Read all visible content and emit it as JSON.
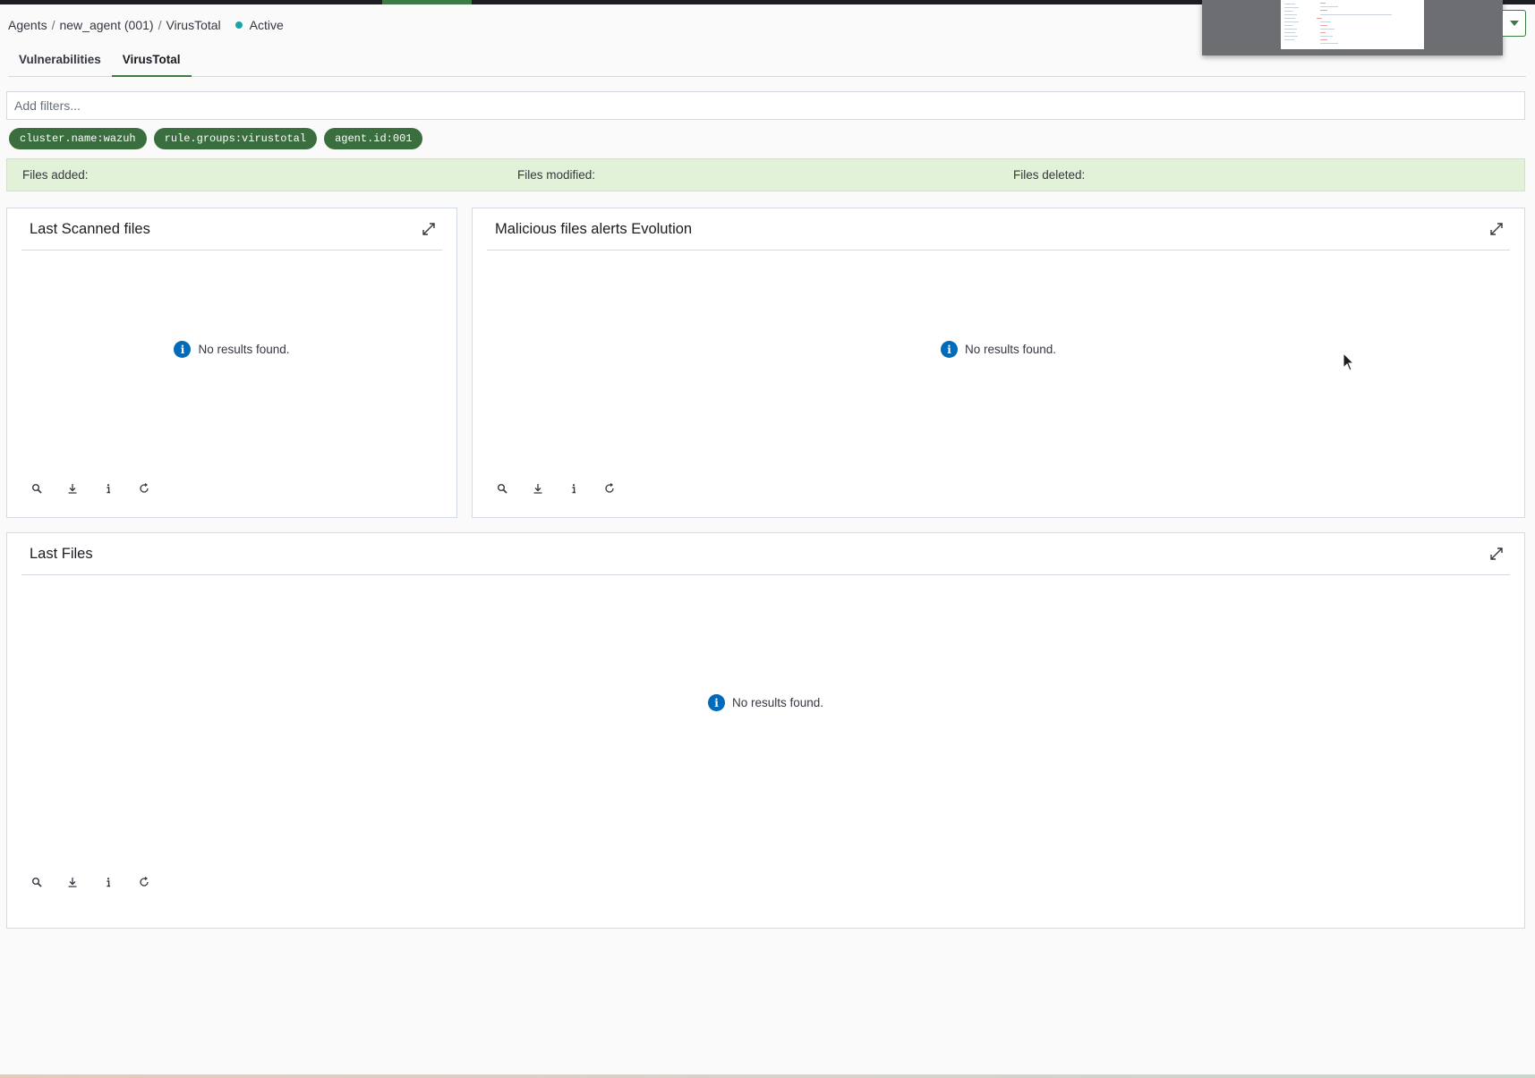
{
  "breadcrumb": {
    "agents": "Agents",
    "agent": "new_agent (001)",
    "current": "VirusTotal",
    "separator": "/"
  },
  "status": {
    "label": "Active",
    "color": "#1aa5a5"
  },
  "tabs": [
    {
      "label": "Vulnerabilities",
      "active": false
    },
    {
      "label": "VirusTotal",
      "active": true
    }
  ],
  "filter": {
    "placeholder": "Add filters..."
  },
  "pills": [
    "cluster.name:wazuh",
    "rule.groups:virustotal",
    "agent.id:001"
  ],
  "stats": {
    "files_added": "Files added:",
    "files_modified": "Files modified:",
    "files_deleted": "Files deleted:"
  },
  "panels": {
    "last_scanned": {
      "title": "Last Scanned files",
      "empty": "No results found."
    },
    "malicious_evolution": {
      "title": "Malicious files alerts Evolution",
      "empty": "No results found."
    },
    "last_files": {
      "title": "Last Files",
      "empty": "No results found."
    }
  },
  "colors": {
    "accent": "#3d7a46",
    "pill": "#3b6e3f",
    "info": "#006bb8",
    "stats_bg": "#e2f2d9"
  },
  "icons": {
    "toolbar": [
      "search-icon",
      "download-icon",
      "info-icon",
      "refresh-icon"
    ],
    "expand": "expand-icon"
  }
}
